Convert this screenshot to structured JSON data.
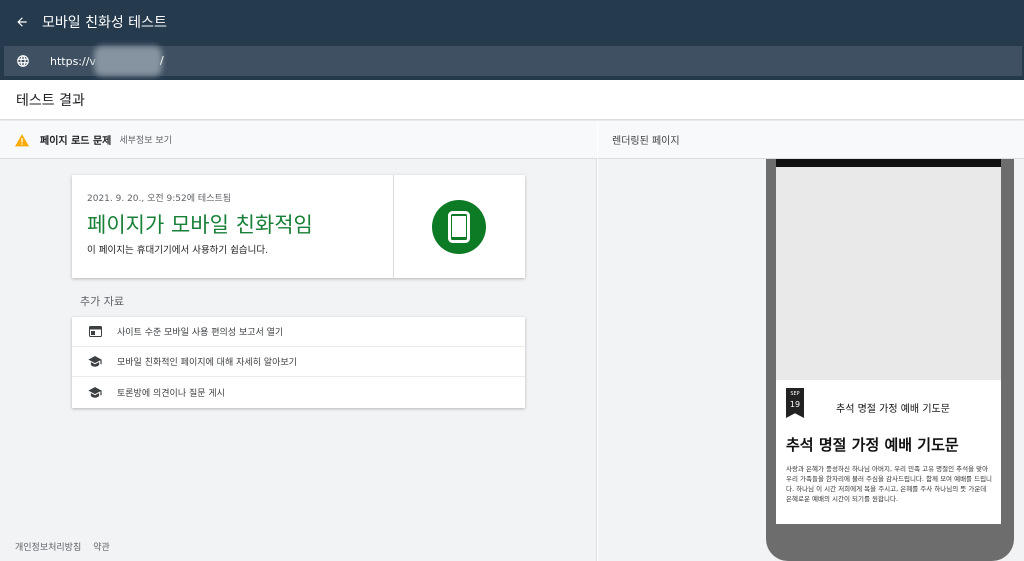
{
  "app": {
    "title": "모바일 친화성 테스트"
  },
  "url": {
    "prefix": "https://v",
    "suffix": "/"
  },
  "results_label": "테스트 결과",
  "load_issue": {
    "label": "페이지 로드 문제",
    "details_link": "세부정보 보기"
  },
  "result_card": {
    "timestamp": "2021. 9. 20., 오전 9:52에 테스트됨",
    "verdict": "페이지가 모바일 친화적임",
    "description": "이 페이지는 휴대기기에서 사용하기 쉽습니다.",
    "verdict_color": "#188038"
  },
  "more_resources": {
    "title": "추가 자료",
    "items": [
      {
        "label": "사이트 수준 모바일 사용 편의성 보고서 열기",
        "icon": "report-icon"
      },
      {
        "label": "모바일 친화적인 페이지에 대해 자세히 알아보기",
        "icon": "school-icon"
      },
      {
        "label": "토론방에 의견이나 질문 게시",
        "icon": "school-icon"
      }
    ]
  },
  "footer": {
    "privacy": "개인정보처리방침",
    "terms": "약관"
  },
  "rendered": {
    "header": "렌더링된 페이지",
    "post": {
      "month": "SEP",
      "day": "19",
      "small_title": "추석 명절 가정 예배 기도문",
      "title": "추석 명절 가정 예배 기도문",
      "body": "사랑과 은혜가 풍성하신 하나님 아버지, 우리 민족 고유 명절인 추석을 맞아 우리 가족들을 한자리에 불러 주심을 감사드립니다. 함께 모여 예배를 드립니다. 하나님 이 시간 저희에게 복을 주시고, 은혜를 주사 하나님의 뜻 가운데 은혜로운 예배의 시간이 되기를 원합니다."
    }
  },
  "colors": {
    "appbar": "#263a4d",
    "success": "#0d7a26",
    "warning": "#f9ab00"
  }
}
